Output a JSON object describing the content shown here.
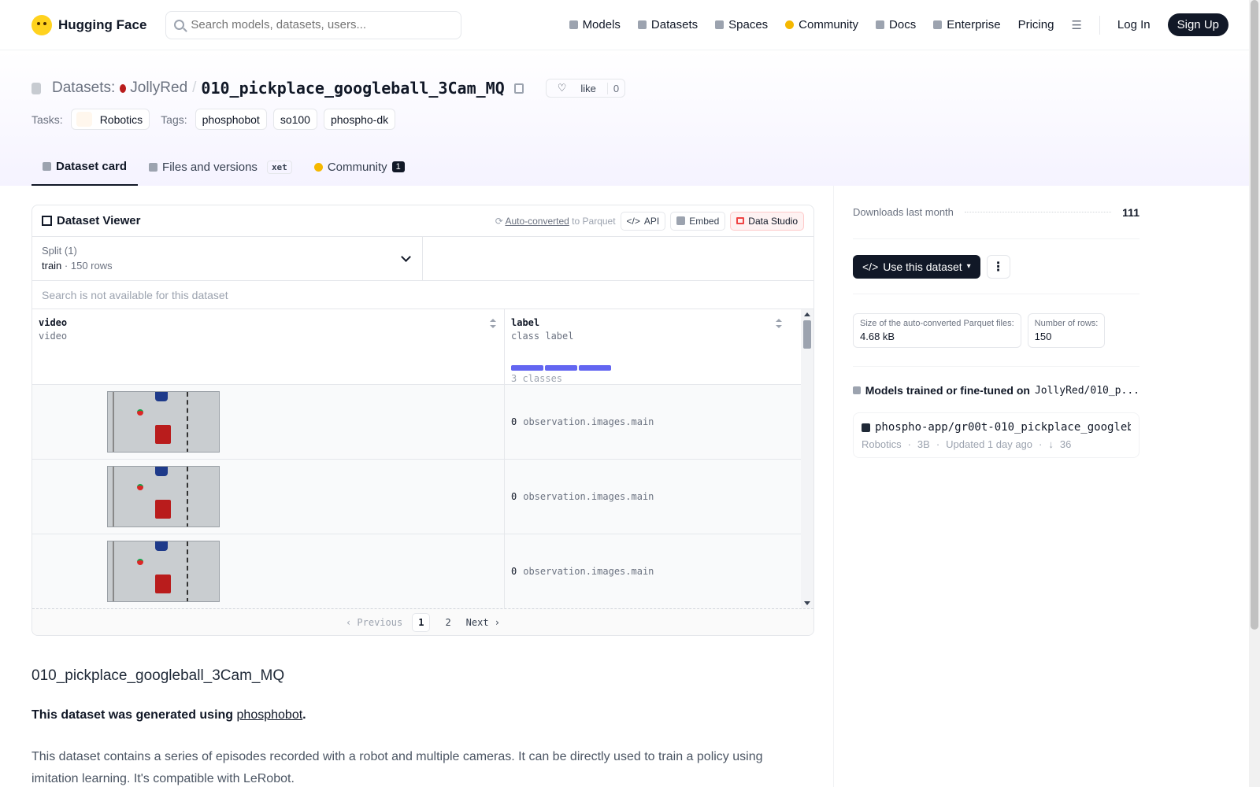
{
  "topnav": {
    "brand": "Hugging Face",
    "search_placeholder": "Search models, datasets, users...",
    "items": [
      {
        "label": "Models"
      },
      {
        "label": "Datasets"
      },
      {
        "label": "Spaces"
      },
      {
        "label": "Community"
      },
      {
        "label": "Docs"
      },
      {
        "label": "Enterprise"
      },
      {
        "label": "Pricing"
      }
    ],
    "login": "Log In",
    "signup": "Sign Up"
  },
  "header": {
    "datasets_label": "Datasets:",
    "owner": "JollyRed",
    "separator": "/",
    "name": "010_pickplace_googleball_3Cam_MQ",
    "like_label": "like",
    "like_count": "0",
    "tasks_label": "Tasks:",
    "task": "Robotics",
    "tags_label": "Tags:",
    "tags": [
      "phosphobot",
      "so100",
      "phospho-dk"
    ]
  },
  "tabs": {
    "card": "Dataset card",
    "files": "Files and versions",
    "xet": "xet",
    "community": "Community",
    "community_count": "1"
  },
  "viewer": {
    "title": "Dataset Viewer",
    "auto_converted": "Auto-converted",
    "to_parquet": "to Parquet",
    "api": "API",
    "embed": "Embed",
    "studio": "Data Studio",
    "split_label": "Split (1)",
    "split_value": "train",
    "split_rows": "150 rows",
    "search_na": "Search is not available for this dataset",
    "col1_name": "video",
    "col1_type": "video",
    "col2_name": "label",
    "col2_type": "class label",
    "classes": "3 classes",
    "rows": [
      {
        "label_id": "0",
        "label_name": "observation.images.main"
      },
      {
        "label_id": "0",
        "label_name": "observation.images.main"
      },
      {
        "label_id": "0",
        "label_name": "observation.images.main"
      }
    ],
    "pager": {
      "prev": "Previous",
      "p1": "1",
      "p2": "2",
      "next": "Next"
    }
  },
  "readme": {
    "title": "010_pickplace_googleball_3Cam_MQ",
    "generated_prefix": "This dataset was generated using",
    "generated_link": "phosphobot",
    "generated_suffix": ".",
    "description": "This dataset contains a series of episodes recorded with a robot and multiple cameras. It can be directly used to train a policy using imitation learning. It's compatible with LeRobot."
  },
  "sidebar": {
    "downloads_label": "Downloads last month",
    "downloads": "111",
    "use_button": "Use this dataset",
    "size_label": "Size of the auto-converted Parquet files:",
    "size_value": "4.68 kB",
    "rows_label": "Number of rows:",
    "rows_value": "150",
    "models_heading": "Models trained or fine-tuned on",
    "models_repo": "JollyRed/010_p...",
    "model_name": "phospho-app/gr00t-010_pickplace_googleb...",
    "model_task": "Robotics",
    "model_size": "3B",
    "model_updated": "Updated 1 day ago",
    "model_downloads": "36"
  }
}
